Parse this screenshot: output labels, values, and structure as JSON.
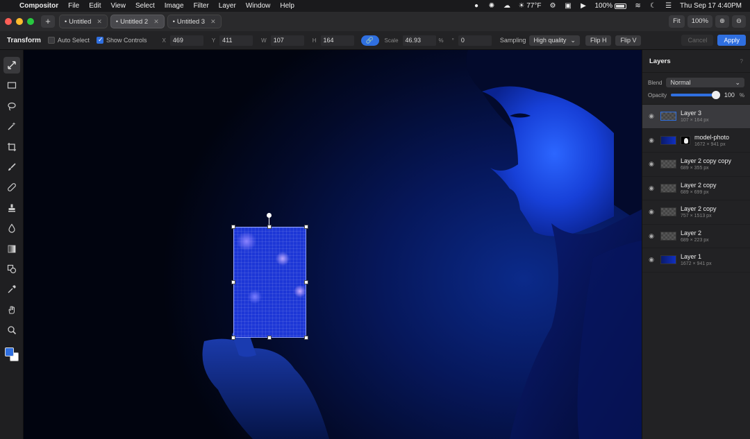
{
  "menubar": {
    "app_name": "Compositor",
    "menus": [
      "File",
      "Edit",
      "View",
      "Select",
      "Image",
      "Filter",
      "Layer",
      "Window",
      "Help"
    ],
    "weather": "☀ 77°F",
    "battery": "100%",
    "datetime": "Thu Sep 17  4:40PM"
  },
  "tabs": [
    {
      "label": "Untitled",
      "active": false
    },
    {
      "label": "Untitled 2",
      "active": true
    },
    {
      "label": "Untitled 3",
      "active": false
    }
  ],
  "view": {
    "fit_label": "Fit",
    "zoom": "100%"
  },
  "options": {
    "tool_title": "Transform",
    "auto_select_label": "Auto Select",
    "show_controls_label": "Show Controls",
    "x_label": "X",
    "x": "469",
    "y_label": "Y",
    "y": "411",
    "w_label": "W",
    "w": "107",
    "h_label": "H",
    "h": "164",
    "scale_label": "Scale",
    "scale": "46.93",
    "percent": "%",
    "rotation_label": "°",
    "rotation": "0",
    "sampling_label": "Sampling",
    "sampling": "High quality",
    "flip_h": "Flip H",
    "flip_v": "Flip V",
    "cancel": "Cancel",
    "apply": "Apply"
  },
  "panel": {
    "title": "Layers",
    "menu": "?",
    "blend_label": "Blend",
    "blend_mode": "Normal",
    "opacity_label": "Opacity",
    "opacity": "100",
    "opacity_unit": "%",
    "opacity_fraction": 1.0,
    "layers": [
      {
        "name": "Layer 3",
        "size": "107 × 164 px",
        "selected": true
      },
      {
        "name": "model-photo",
        "size": "1672 × 941 px",
        "selected": false
      },
      {
        "name": "Layer 2 copy copy",
        "size": "689 × 355 px",
        "selected": false
      },
      {
        "name": "Layer 2 copy",
        "size": "689 × 699 px",
        "selected": false
      },
      {
        "name": "Layer 2 copy",
        "size": "757 × 1513 px",
        "selected": false
      },
      {
        "name": "Layer 2",
        "size": "689 × 223 px",
        "selected": false
      },
      {
        "name": "Layer 1",
        "size": "1672 × 941 px",
        "selected": false
      }
    ]
  },
  "colors": {
    "accent": "#2f6fe0",
    "foreground": "#2f6fe0",
    "background": "#ffffff"
  }
}
